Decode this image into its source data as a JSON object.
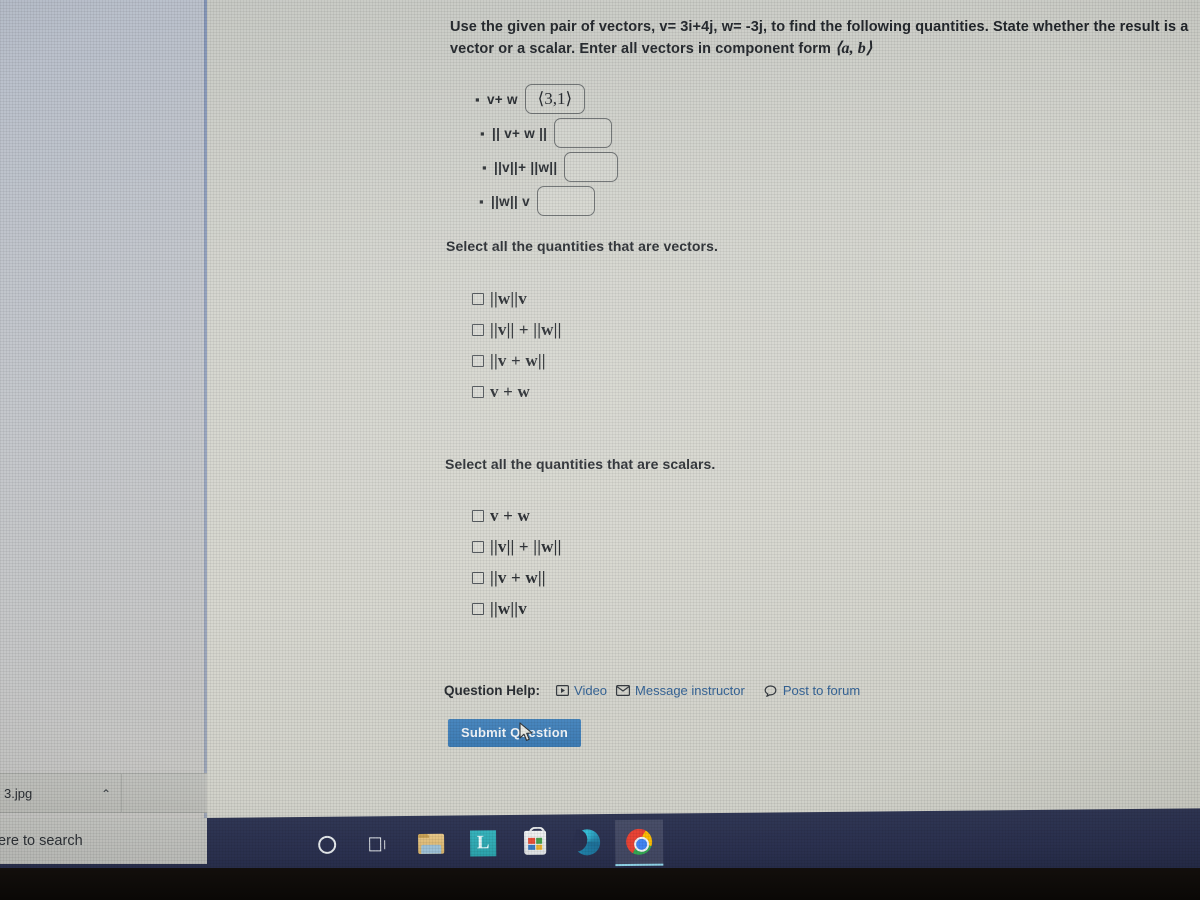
{
  "question": {
    "stem_part1": "Use the given pair of vectors,",
    "vector_v": "v= 3i+4j",
    "comma1": ",",
    "vector_w": "w= -3j",
    "comma2": ",",
    "stem_part2": "to find the following quantities. State whether the result is a vector or a scalar. Enter all vectors in component form",
    "component_form": "⟨a, b⟩"
  },
  "answer_items": [
    {
      "label": "v+ w",
      "value": "⟨3,1⟩",
      "placeholder": ""
    },
    {
      "label": "|| v+ w ||",
      "value": "",
      "placeholder": ""
    },
    {
      "label": "||v||+ ||w||",
      "value": "",
      "placeholder": ""
    },
    {
      "label": "||w|| v",
      "value": "",
      "placeholder": ""
    }
  ],
  "vectors_section": {
    "prompt": "Select all the quantities that are vectors.",
    "choices": [
      {
        "label": "||w||v",
        "checked": false
      },
      {
        "label": "||v|| + ||w||",
        "checked": false
      },
      {
        "label": "||v + w||",
        "checked": false
      },
      {
        "label": "v + w",
        "checked": false
      }
    ]
  },
  "scalars_section": {
    "prompt": "Select all the quantities that are scalars.",
    "choices": [
      {
        "label": "v + w",
        "checked": false
      },
      {
        "label": "||v|| + ||w||",
        "checked": false
      },
      {
        "label": "||v + w||",
        "checked": false
      },
      {
        "label": "||w||v",
        "checked": false
      }
    ]
  },
  "help": {
    "label": "Question Help:",
    "links": [
      {
        "text": "Video",
        "icon": "play-icon"
      },
      {
        "text": "Message instructor",
        "icon": "envelope-icon"
      },
      {
        "text": "Post to forum",
        "icon": "speech-bubble-icon"
      }
    ]
  },
  "submit": {
    "label": "Submit Question"
  },
  "download_bar": {
    "filename": "3.jpg",
    "chevron": "⌃"
  },
  "taskbar": {
    "search_text": "ere to search",
    "icons": [
      {
        "name": "cortana-icon",
        "label": "Cortana"
      },
      {
        "name": "task-view-icon",
        "label": "Task View"
      },
      {
        "name": "file-explorer-icon",
        "label": "File Explorer"
      },
      {
        "name": "lockdown-browser-icon",
        "label": "L"
      },
      {
        "name": "microsoft-store-icon",
        "label": "Microsoft Store"
      },
      {
        "name": "edge-icon",
        "label": "Microsoft Edge"
      },
      {
        "name": "chrome-icon",
        "label": "Google Chrome"
      }
    ]
  },
  "colors": {
    "page_background": "#d4d5ce",
    "desktop_panel": "#c3c6cb",
    "submit_blue": "#3b7cb8",
    "link_blue": "#2f5f93",
    "taskbar": "#2b3150",
    "text": "#22262b"
  }
}
